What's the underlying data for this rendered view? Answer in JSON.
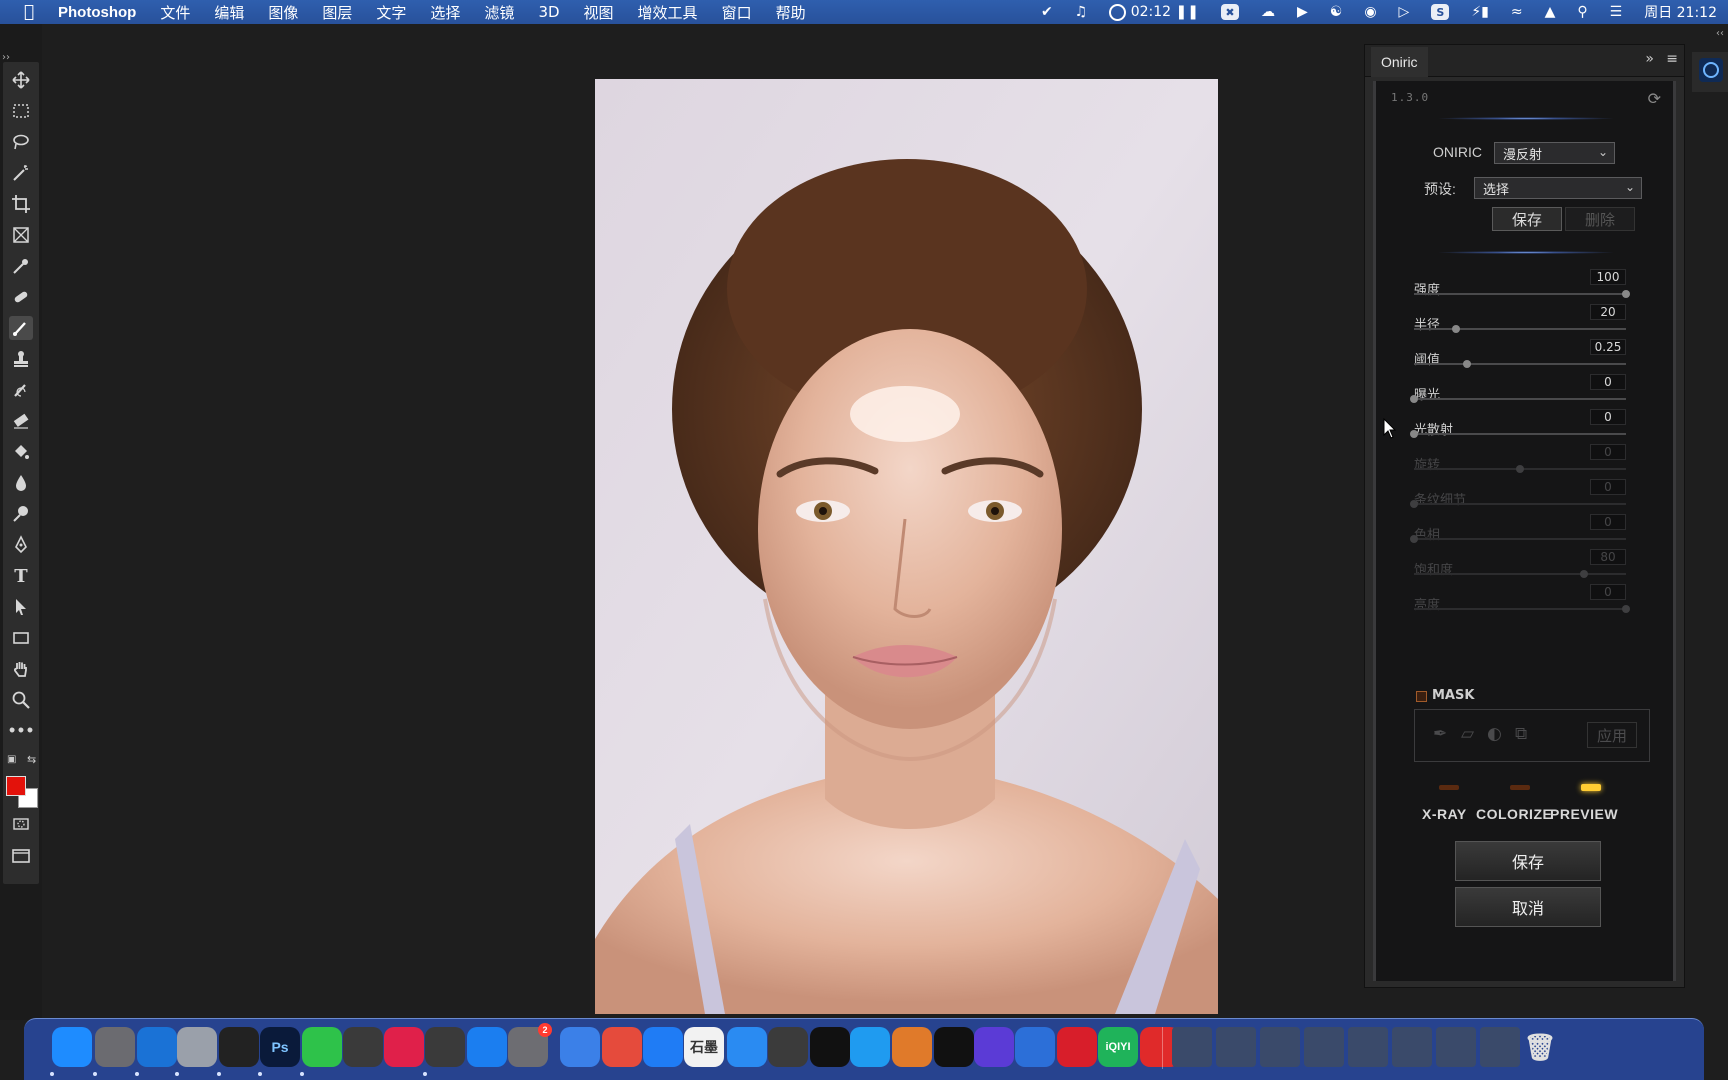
{
  "menubar": {
    "app_name": "Photoshop",
    "menus": [
      "文件",
      "编辑",
      "图像",
      "图层",
      "文字",
      "选择",
      "滤镜",
      "3D",
      "视图",
      "增效工具",
      "窗口",
      "帮助"
    ],
    "recording_time": "02:12",
    "clock": "周日 21:12"
  },
  "panel": {
    "tab_label": "Oniric",
    "version": "1.3.0",
    "oniric_label": "ONIRIC",
    "mode_value": "漫反射",
    "preset_label": "预设:",
    "preset_value": "选择",
    "preset_save": "保存",
    "preset_delete": "删除",
    "sliders": [
      {
        "label": "强度",
        "value": "100",
        "level": 1.0,
        "enabled": true
      },
      {
        "label": "半径",
        "value": "20",
        "level": 0.2,
        "enabled": true
      },
      {
        "label": "阈值",
        "value": "0.25",
        "level": 0.25,
        "enabled": true
      },
      {
        "label": "曝光",
        "value": "0",
        "level": 0.0,
        "enabled": true
      },
      {
        "label": "光散射",
        "value": "0",
        "level": 0.0,
        "enabled": true
      },
      {
        "label": "旋转",
        "value": "0",
        "level": 0.5,
        "enabled": false
      },
      {
        "label": "条纹细节",
        "value": "0",
        "level": 0.0,
        "enabled": false
      },
      {
        "label": "色相",
        "value": "0",
        "level": 0.0,
        "enabled": false
      },
      {
        "label": "饱和度",
        "value": "80",
        "level": 0.8,
        "enabled": false
      },
      {
        "label": "亮度",
        "value": "0",
        "level": 1.0,
        "enabled": false
      }
    ],
    "mask_label": "MASK",
    "mask_apply": "应用",
    "toggles": [
      {
        "label": "X-RAY",
        "on": false
      },
      {
        "label": "COLORIZE",
        "on": false
      },
      {
        "label": "PREVIEW",
        "on": true
      }
    ],
    "save_button": "保存",
    "cancel_button": "取消"
  },
  "colors": {
    "foreground": "#e3120b",
    "background": "#ffffff",
    "accent_glow": "#8ab4ff",
    "preview_led": "#ffcc33"
  },
  "dock": {
    "apps": [
      "finder",
      "launchpad",
      "safari",
      "preview",
      "terminal",
      "Ps",
      "wechat",
      "screenshot",
      "pockity",
      "final-cut-pro",
      "app-store",
      "system-settings",
      "baidu-netdisk",
      "chrome",
      "feishu",
      "石墨",
      "todesk",
      "pencil",
      "tiktok",
      "mail",
      "books",
      "capcut",
      "filmora",
      "qq-browser",
      "netease-music",
      "iQIYI",
      "wps"
    ],
    "settings_badge": "2"
  }
}
